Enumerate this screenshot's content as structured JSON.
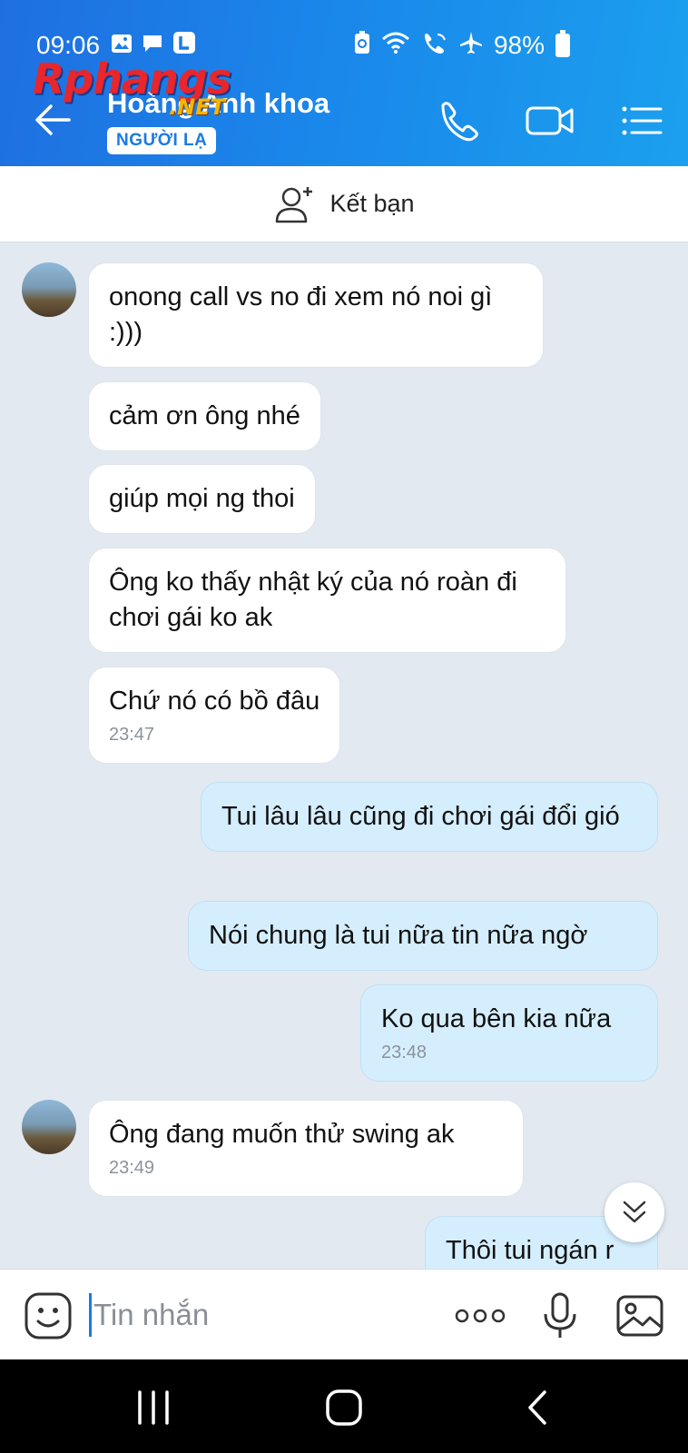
{
  "status_bar": {
    "time": "09:06",
    "battery": "98%"
  },
  "header": {
    "back_label": "back",
    "title": "Hoàng Anh khoa",
    "badge": "NGƯỜI LẠ",
    "watermark_main": "Rphangs",
    "watermark_sub": ".NET",
    "icons": [
      "call-icon",
      "video-call-icon",
      "menu-list-icon"
    ]
  },
  "add_friend": {
    "label": "Kết bạn"
  },
  "messages": [
    {
      "sender": "other",
      "text": "onong call vs no đi xem nó noi gì :)))"
    },
    {
      "sender": "other",
      "text": "cảm ơn ông nhé"
    },
    {
      "sender": "other",
      "text": "giúp mọi ng thoi"
    },
    {
      "sender": "other",
      "text": "Ông ko thấy nhật ký của nó roàn đi chơi gái ko ak"
    },
    {
      "sender": "other",
      "text": "Chứ nó có bồ đâu",
      "time": "23:47"
    },
    {
      "sender": "me",
      "text": "Tui lâu lâu cũng đi chơi gái đổi gió"
    },
    {
      "sender": "me",
      "text": "Nói chung là tui nữa tin nữa ngờ"
    },
    {
      "sender": "me",
      "text": "Ko qua bên kia nữa",
      "time": "23:48"
    },
    {
      "sender": "other",
      "text": "Ông đang muốn thử swing ak",
      "time": "23:49"
    },
    {
      "sender": "me",
      "text": "Thôi tui ngán r"
    }
  ],
  "composer": {
    "placeholder": "Tin nhắn"
  },
  "colors": {
    "header_start": "#1f6fe0",
    "header_end": "#1ba0ee",
    "my_bubble": "#d5eefd",
    "chat_bg": "#e2e9f1"
  }
}
